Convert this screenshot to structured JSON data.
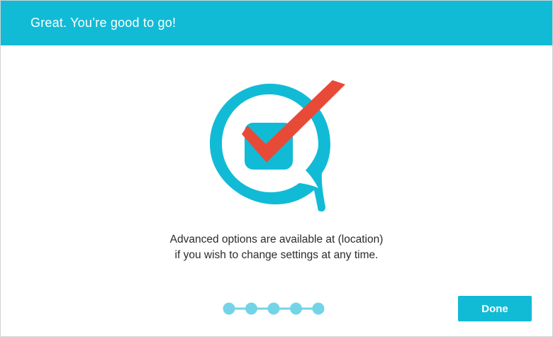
{
  "header": {
    "title": "Great. You’re good to go!"
  },
  "logo": {
    "icon": "chat-bubble-checkmark-icon",
    "bubble_color": "#11bbd6",
    "check_color": "#e84a38"
  },
  "message": {
    "line1": "Advanced options are available at (location)",
    "line2": "if you wish to change settings at any time."
  },
  "progress": {
    "total_steps": 5,
    "current_step": 5,
    "color": "#73d4e8"
  },
  "actions": {
    "done_label": "Done"
  },
  "colors": {
    "accent": "#11bbd6",
    "check": "#e84a38",
    "progress_dot": "#73d4e8"
  }
}
